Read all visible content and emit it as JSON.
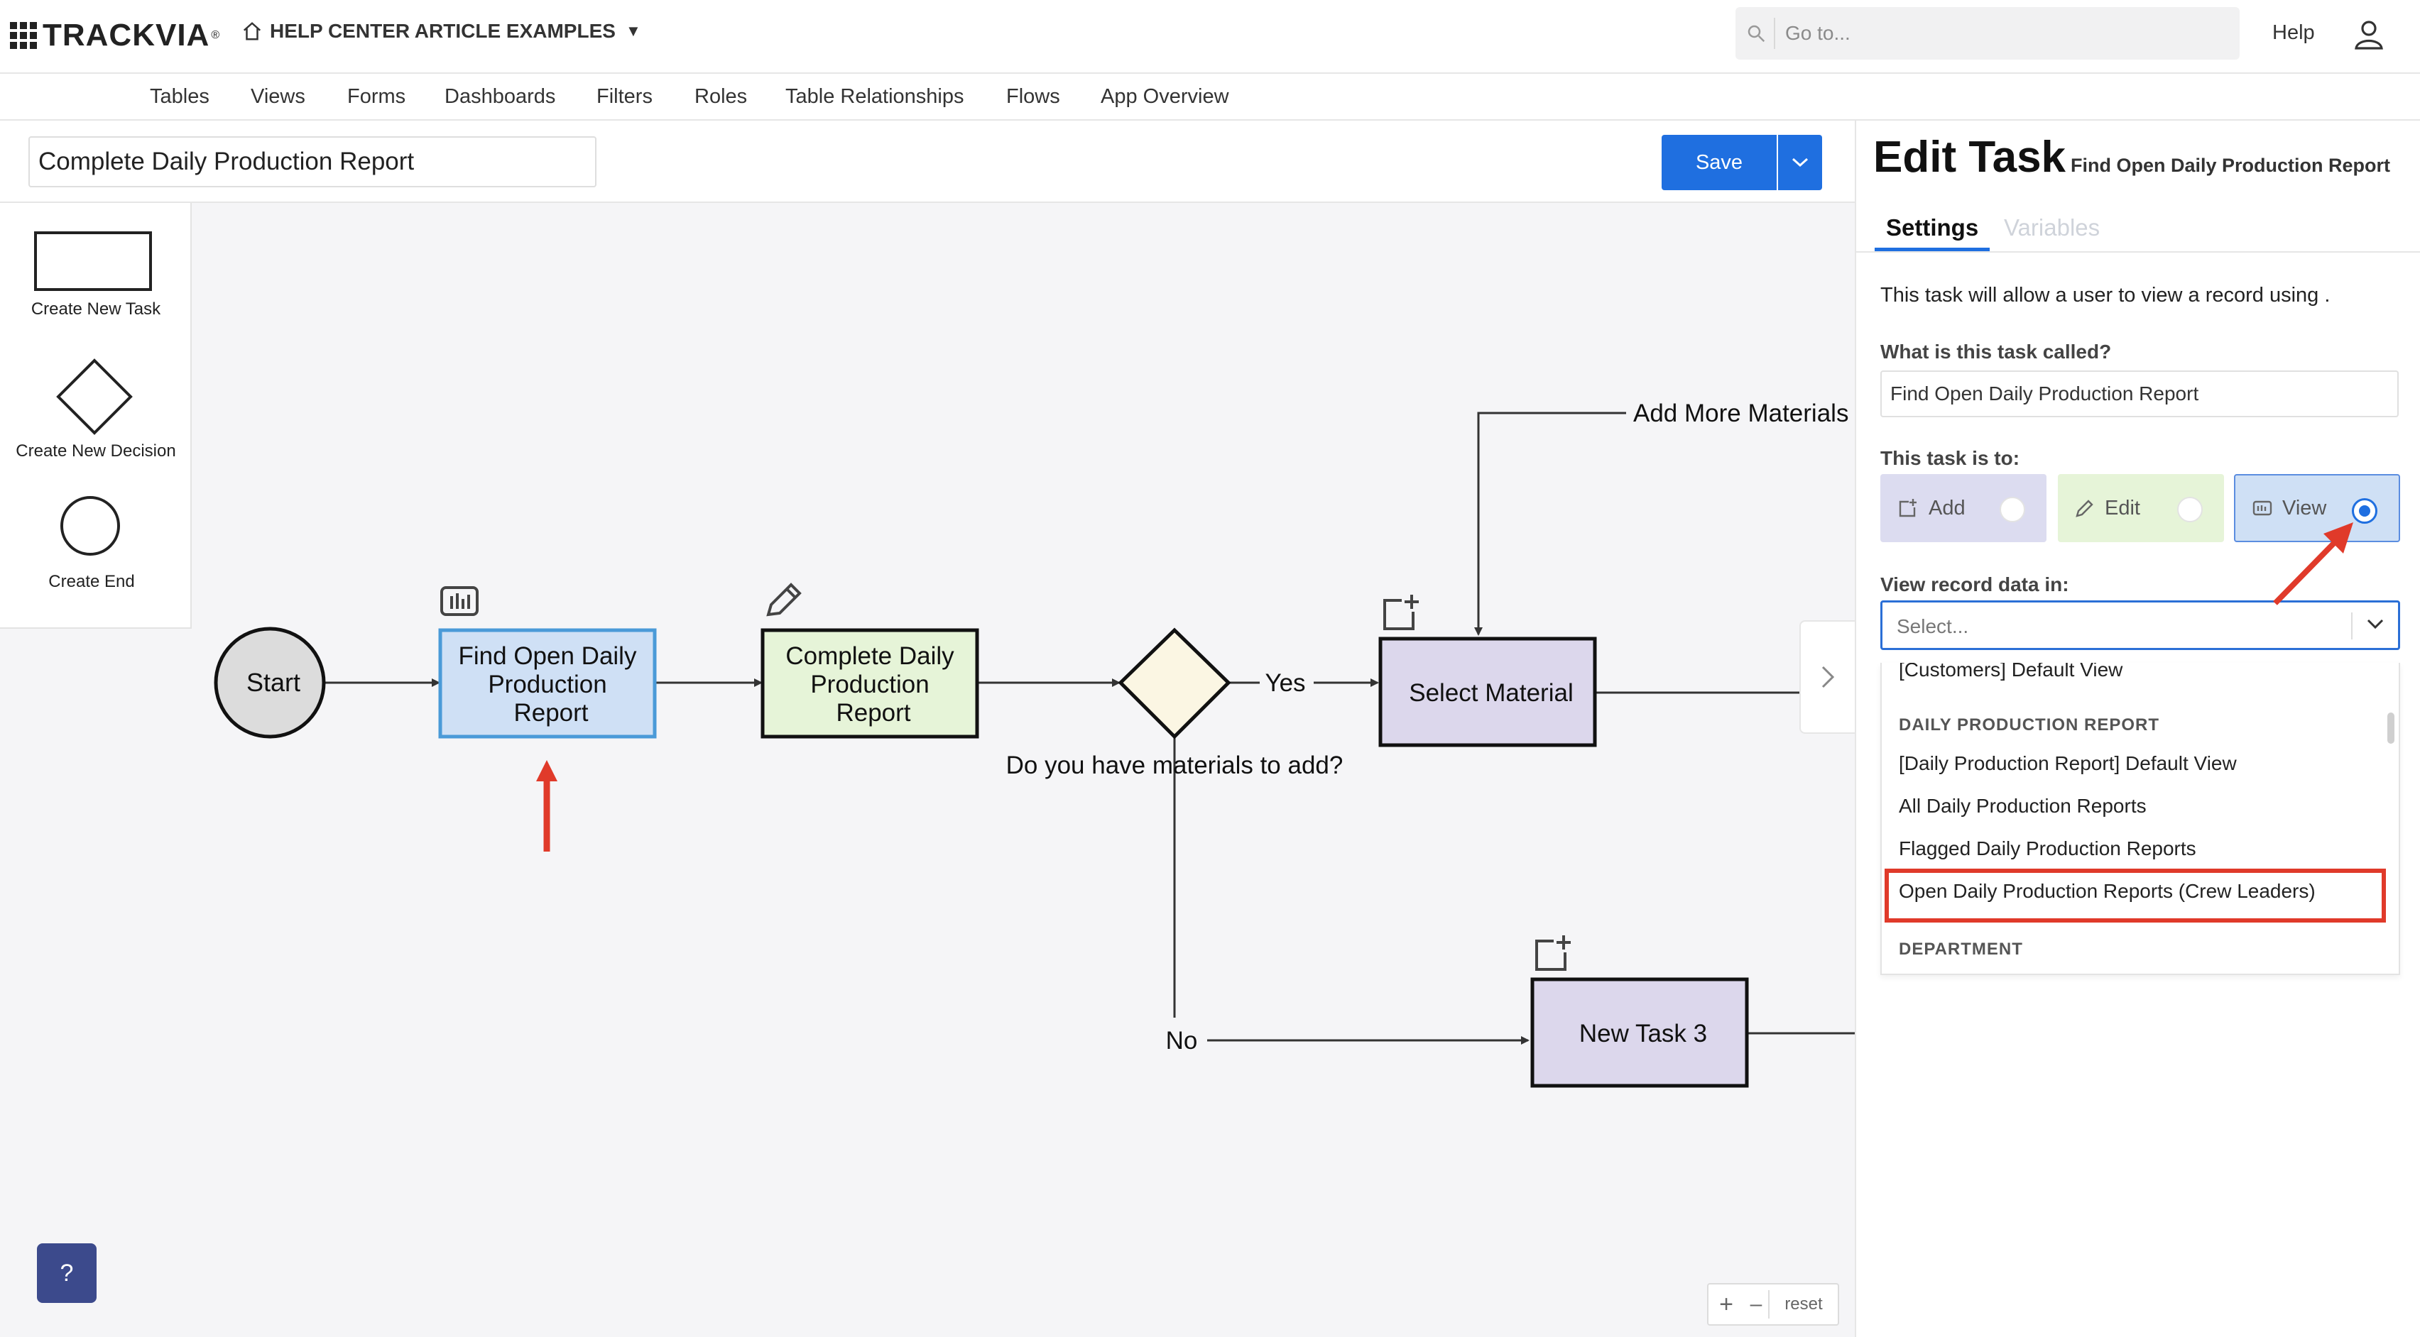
{
  "header": {
    "logo_text": "TRACKVIA",
    "app_name": "HELP CENTER ARTICLE EXAMPLES",
    "search_placeholder": "Go to...",
    "help_label": "Help"
  },
  "nav": {
    "items": [
      "Tables",
      "Views",
      "Forms",
      "Dashboards",
      "Filters",
      "Roles",
      "Table Relationships",
      "Flows",
      "App Overview"
    ]
  },
  "flow_editor": {
    "flow_name": "Complete Daily Production Report",
    "save_label": "Save",
    "palette": {
      "task": "Create New Task",
      "decision": "Create New Decision",
      "end": "Create End"
    },
    "nodes": {
      "start": "Start",
      "find_line1": "Find Open Daily",
      "find_line2": "Production",
      "find_line3": "Report",
      "complete_line1": "Complete Daily",
      "complete_line2": "Production",
      "complete_line3": "Report",
      "decision_question": "Do you have materials to add?",
      "yes": "Yes",
      "no": "No",
      "select_material": "Select Material",
      "new_task": "New Task 3",
      "add_more": "Add More Materials"
    },
    "help_fab": "?",
    "zoom": {
      "plus": "+",
      "minus": "–",
      "reset": "reset"
    }
  },
  "panel": {
    "title": "Edit Task",
    "subtitle": "Find Open Daily Production Report",
    "tabs": {
      "settings": "Settings",
      "variables": "Variables"
    },
    "description": "This task will allow a user to view a record using .",
    "task_name_label": "What is this task called?",
    "task_name_value": "Find Open Daily Production Report",
    "task_type_label": "This task is to:",
    "options": {
      "add": "Add",
      "edit": "Edit",
      "view": "View"
    },
    "selected_option": "View",
    "view_data_label": "View record data in:",
    "select_placeholder": "Select...",
    "dropdown": {
      "items_top": "[Customers] Default View",
      "group1": "DAILY PRODUCTION REPORT",
      "group1_items": [
        "[Daily Production Report] Default View",
        "All Daily Production Reports",
        "Flagged Daily Production Reports",
        "Open Daily Production Reports (Crew Leaders)"
      ],
      "group2": "DEPARTMENT"
    }
  },
  "colors": {
    "accent": "#1f6fe0",
    "annotation": "#e03a2a",
    "find_node": "#cfe0f5",
    "complete_node": "#e6f4d8",
    "material_node": "#dcd7ec",
    "decision_fill": "#fbf6e3",
    "start_fill": "#dcdcdc"
  }
}
